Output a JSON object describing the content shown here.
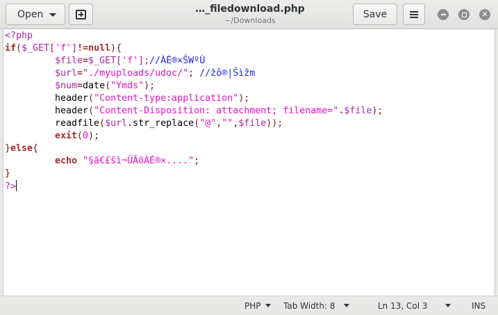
{
  "header": {
    "open_label": "Open",
    "save_label": "Save",
    "title": "…_filedownload.php",
    "subtitle": "~/Downloads"
  },
  "code_lines": [
    {
      "tokens": [
        {
          "t": "<?php",
          "c": "pre"
        }
      ]
    },
    {
      "tokens": [
        {
          "t": "if",
          "c": "kw"
        },
        {
          "t": "(",
          "c": "punc"
        },
        {
          "t": "$_GET[",
          "c": "var"
        },
        {
          "t": "'f'",
          "c": "str"
        },
        {
          "t": "]",
          "c": "var"
        },
        {
          "t": "!=null",
          "c": "kw"
        },
        {
          "t": "){",
          "c": "punc"
        }
      ]
    },
    {
      "indent": true,
      "tokens": [
        {
          "t": "$file",
          "c": "var"
        },
        {
          "t": "=",
          "c": "kw"
        },
        {
          "t": "$_GET[",
          "c": "var"
        },
        {
          "t": "'f'",
          "c": "str"
        },
        {
          "t": "];",
          "c": "var"
        },
        {
          "t": "//ÀÉ®×ŠWºÙ",
          "c": "com"
        }
      ]
    },
    {
      "indent": true,
      "tokens": [
        {
          "t": "$url",
          "c": "var"
        },
        {
          "t": "=",
          "c": "kw"
        },
        {
          "t": "\"./myuploads/udoc/\"",
          "c": "str"
        },
        {
          "t": "; ",
          "c": "punc"
        },
        {
          "t": "//žô®|Šìžm",
          "c": "com"
        }
      ]
    },
    {
      "indent": true,
      "tokens": [
        {
          "t": "$num",
          "c": "var"
        },
        {
          "t": "=",
          "c": "kw"
        },
        {
          "t": "date",
          "c": "fn"
        },
        {
          "t": "(",
          "c": "punc"
        },
        {
          "t": "\"Ymds\"",
          "c": "str"
        },
        {
          "t": ");",
          "c": "punc"
        }
      ]
    },
    {
      "indent": true,
      "tokens": [
        {
          "t": "header",
          "c": "fn"
        },
        {
          "t": "(",
          "c": "punc"
        },
        {
          "t": "\"Content-type:application\"",
          "c": "str"
        },
        {
          "t": ");",
          "c": "punc"
        }
      ]
    },
    {
      "indent": true,
      "tokens": [
        {
          "t": "header",
          "c": "fn"
        },
        {
          "t": "(",
          "c": "punc"
        },
        {
          "t": "\"Content-Disposition: attachment; filename=\"",
          "c": "str"
        },
        {
          "t": ".",
          "c": "kw"
        },
        {
          "t": "$file",
          "c": "var"
        },
        {
          "t": ");",
          "c": "punc"
        }
      ]
    },
    {
      "indent": true,
      "tokens": [
        {
          "t": "readfile",
          "c": "fn"
        },
        {
          "t": "(",
          "c": "punc"
        },
        {
          "t": "$url",
          "c": "var"
        },
        {
          "t": ".",
          "c": "kw"
        },
        {
          "t": "str_replace",
          "c": "fn"
        },
        {
          "t": "(",
          "c": "punc"
        },
        {
          "t": "\"@\"",
          "c": "str"
        },
        {
          "t": ",",
          "c": "punc"
        },
        {
          "t": "\"\"",
          "c": "str"
        },
        {
          "t": ",",
          "c": "punc"
        },
        {
          "t": "$file",
          "c": "var"
        },
        {
          "t": "));",
          "c": "punc"
        }
      ]
    },
    {
      "indent": true,
      "tokens": [
        {
          "t": "exit",
          "c": "kw"
        },
        {
          "t": "(",
          "c": "punc"
        },
        {
          "t": "0",
          "c": "str"
        },
        {
          "t": ");",
          "c": "punc"
        }
      ]
    },
    {
      "tokens": [
        {
          "t": "}",
          "c": "punc"
        },
        {
          "t": "else",
          "c": "kw"
        },
        {
          "t": "{",
          "c": "punc"
        }
      ]
    },
    {
      "indent": true,
      "tokens": [
        {
          "t": "echo ",
          "c": "kw"
        },
        {
          "t": "\"§ã€£šì¬ÛÃöÀÉ®×....\"",
          "c": "str"
        },
        {
          "t": ";",
          "c": "punc"
        }
      ]
    },
    {
      "tokens": [
        {
          "t": "}",
          "c": "punc"
        }
      ]
    },
    {
      "cursor": true,
      "tokens": [
        {
          "t": "?>",
          "c": "pre"
        }
      ]
    }
  ],
  "statusbar": {
    "language": "PHP",
    "tab_width": "Tab Width: 8",
    "position": "Ln 13, Col 3",
    "mode": "INS"
  }
}
